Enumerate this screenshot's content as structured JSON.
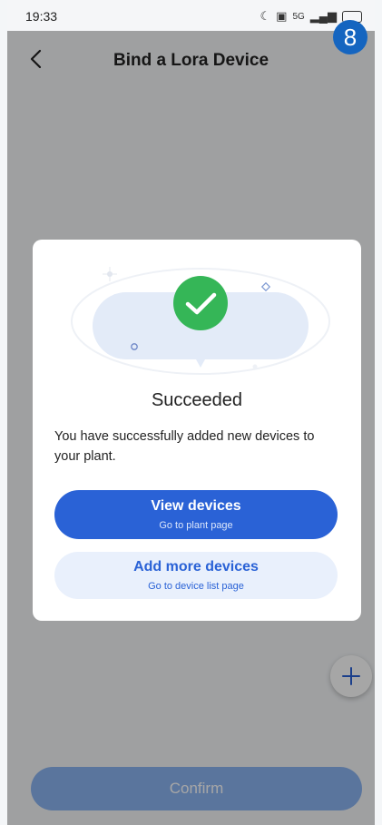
{
  "status_bar": {
    "time": "19:33",
    "icons": [
      "moon-icon",
      "message-icon",
      "signal-icon",
      "battery-icon"
    ],
    "network_label": "5G"
  },
  "step_badge": "8",
  "nav": {
    "title": "Bind a Lora Device",
    "back_icon": "chevron-left-icon"
  },
  "dialog": {
    "title": "Succeeded",
    "description": "You have successfully added new devices to your plant.",
    "primary_button": {
      "label": "View devices",
      "sublabel": "Go to plant page"
    },
    "secondary_button": {
      "label": "Add more devices",
      "sublabel": "Go to device list page"
    },
    "success_icon": "checkmark-icon"
  },
  "fab_icon": "plus-icon",
  "footer": {
    "confirm_label": "Confirm"
  },
  "colors": {
    "primary": "#2a62d6",
    "success": "#35b657",
    "secondary_bg": "#e9f0fc",
    "badge": "#1565c0"
  }
}
